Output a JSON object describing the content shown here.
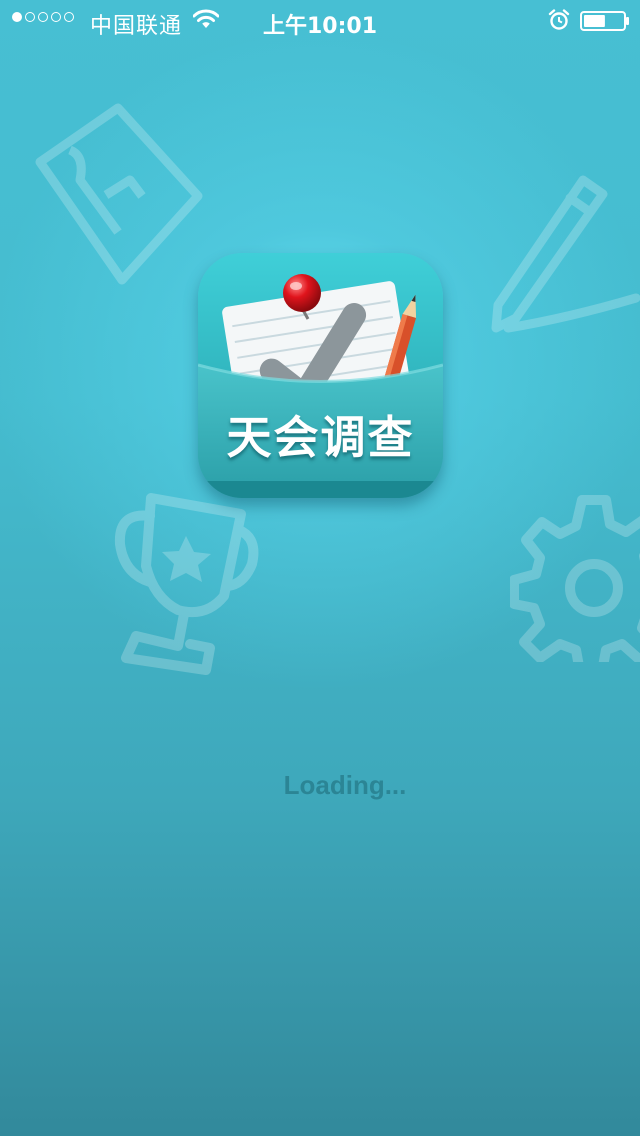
{
  "status_bar": {
    "carrier": "中国联通",
    "time": "上午10:01",
    "signal_bars_filled": 1,
    "signal_bars_total": 5,
    "battery_level": 0.55,
    "icons": [
      "wifi-icon",
      "alarm-icon",
      "battery-icon"
    ]
  },
  "app": {
    "name": "天会调查",
    "icon": "app-logo-icon"
  },
  "decorations": [
    "clipboard-icon",
    "pencil-icon",
    "trophy-icon",
    "gear-icon"
  ],
  "loading": {
    "text": "Loading..."
  },
  "colors": {
    "background_top": "#47bfd3",
    "background_bottom": "#32899b",
    "glow": "#6ee8fa",
    "icon_teal": "#2fb2bb",
    "loading_text": "#2b8595",
    "pin_red": "#e0141c"
  }
}
